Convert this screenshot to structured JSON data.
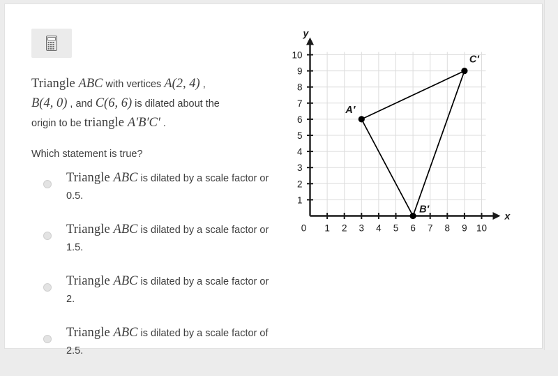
{
  "toolbar": {
    "calculator_label": "calculator-icon"
  },
  "question": {
    "line1_a": "Triangle ",
    "line1_math1": "ABC",
    "line1_b": " with vertices ",
    "line1_math2": "A(2, 4)",
    "line1_c": " ,",
    "line2_math1": "B(4, 0)",
    "line2_a": " , and ",
    "line2_math2": "C(6, 6)",
    "line2_b": " is dilated about the",
    "line3_a": "origin to be ",
    "line3_math1": "triangle ",
    "line3_math2": "A′B′C′",
    "line3_b": " .",
    "prompt": "Which statement is true?"
  },
  "options": [
    {
      "math_prefix": "Triangle ",
      "math_label": "ABC",
      "text": " is dilated by a scale factor or 0.5.",
      "selected": false
    },
    {
      "math_prefix": "Triangle ",
      "math_label": "ABC",
      "text": " is dilated by a scale factor or 1.5.",
      "selected": false
    },
    {
      "math_prefix": "Triangle ",
      "math_label": "ABC",
      "text": " is dilated by a scale factor or 2.",
      "selected": false
    },
    {
      "math_prefix": "Triangle ",
      "math_label": "ABC",
      "text": " is dilated by a scale factor of 2.5.",
      "selected": false
    }
  ],
  "chart_data": {
    "type": "scatter",
    "title": "",
    "xlabel": "x",
    "ylabel": "y",
    "xlim": [
      0,
      10
    ],
    "ylim": [
      0,
      10
    ],
    "xticks": [
      "0",
      "1",
      "2",
      "3",
      "4",
      "5",
      "6",
      "7",
      "8",
      "9",
      "10"
    ],
    "yticks": [
      "1",
      "2",
      "3",
      "4",
      "5",
      "6",
      "7",
      "8",
      "9",
      "10"
    ],
    "origin_label": "0",
    "grid": true,
    "legend": "none",
    "series": [
      {
        "name": "triangle A'B'C'",
        "closed": true,
        "points": [
          {
            "label": "A′",
            "x": 3,
            "y": 6
          },
          {
            "label": "B′",
            "x": 6,
            "y": 0
          },
          {
            "label": "C′",
            "x": 9,
            "y": 9
          }
        ]
      }
    ]
  },
  "colors": {
    "page_background": "#ececec",
    "card_background": "#ffffff",
    "text": "#3d3d3d",
    "grid_line": "#dcdcdc",
    "axis": "#1a1a1a",
    "point": "#000000",
    "radio_fill": "#e3e3e3",
    "calc_button_bg": "#ebebeb"
  }
}
